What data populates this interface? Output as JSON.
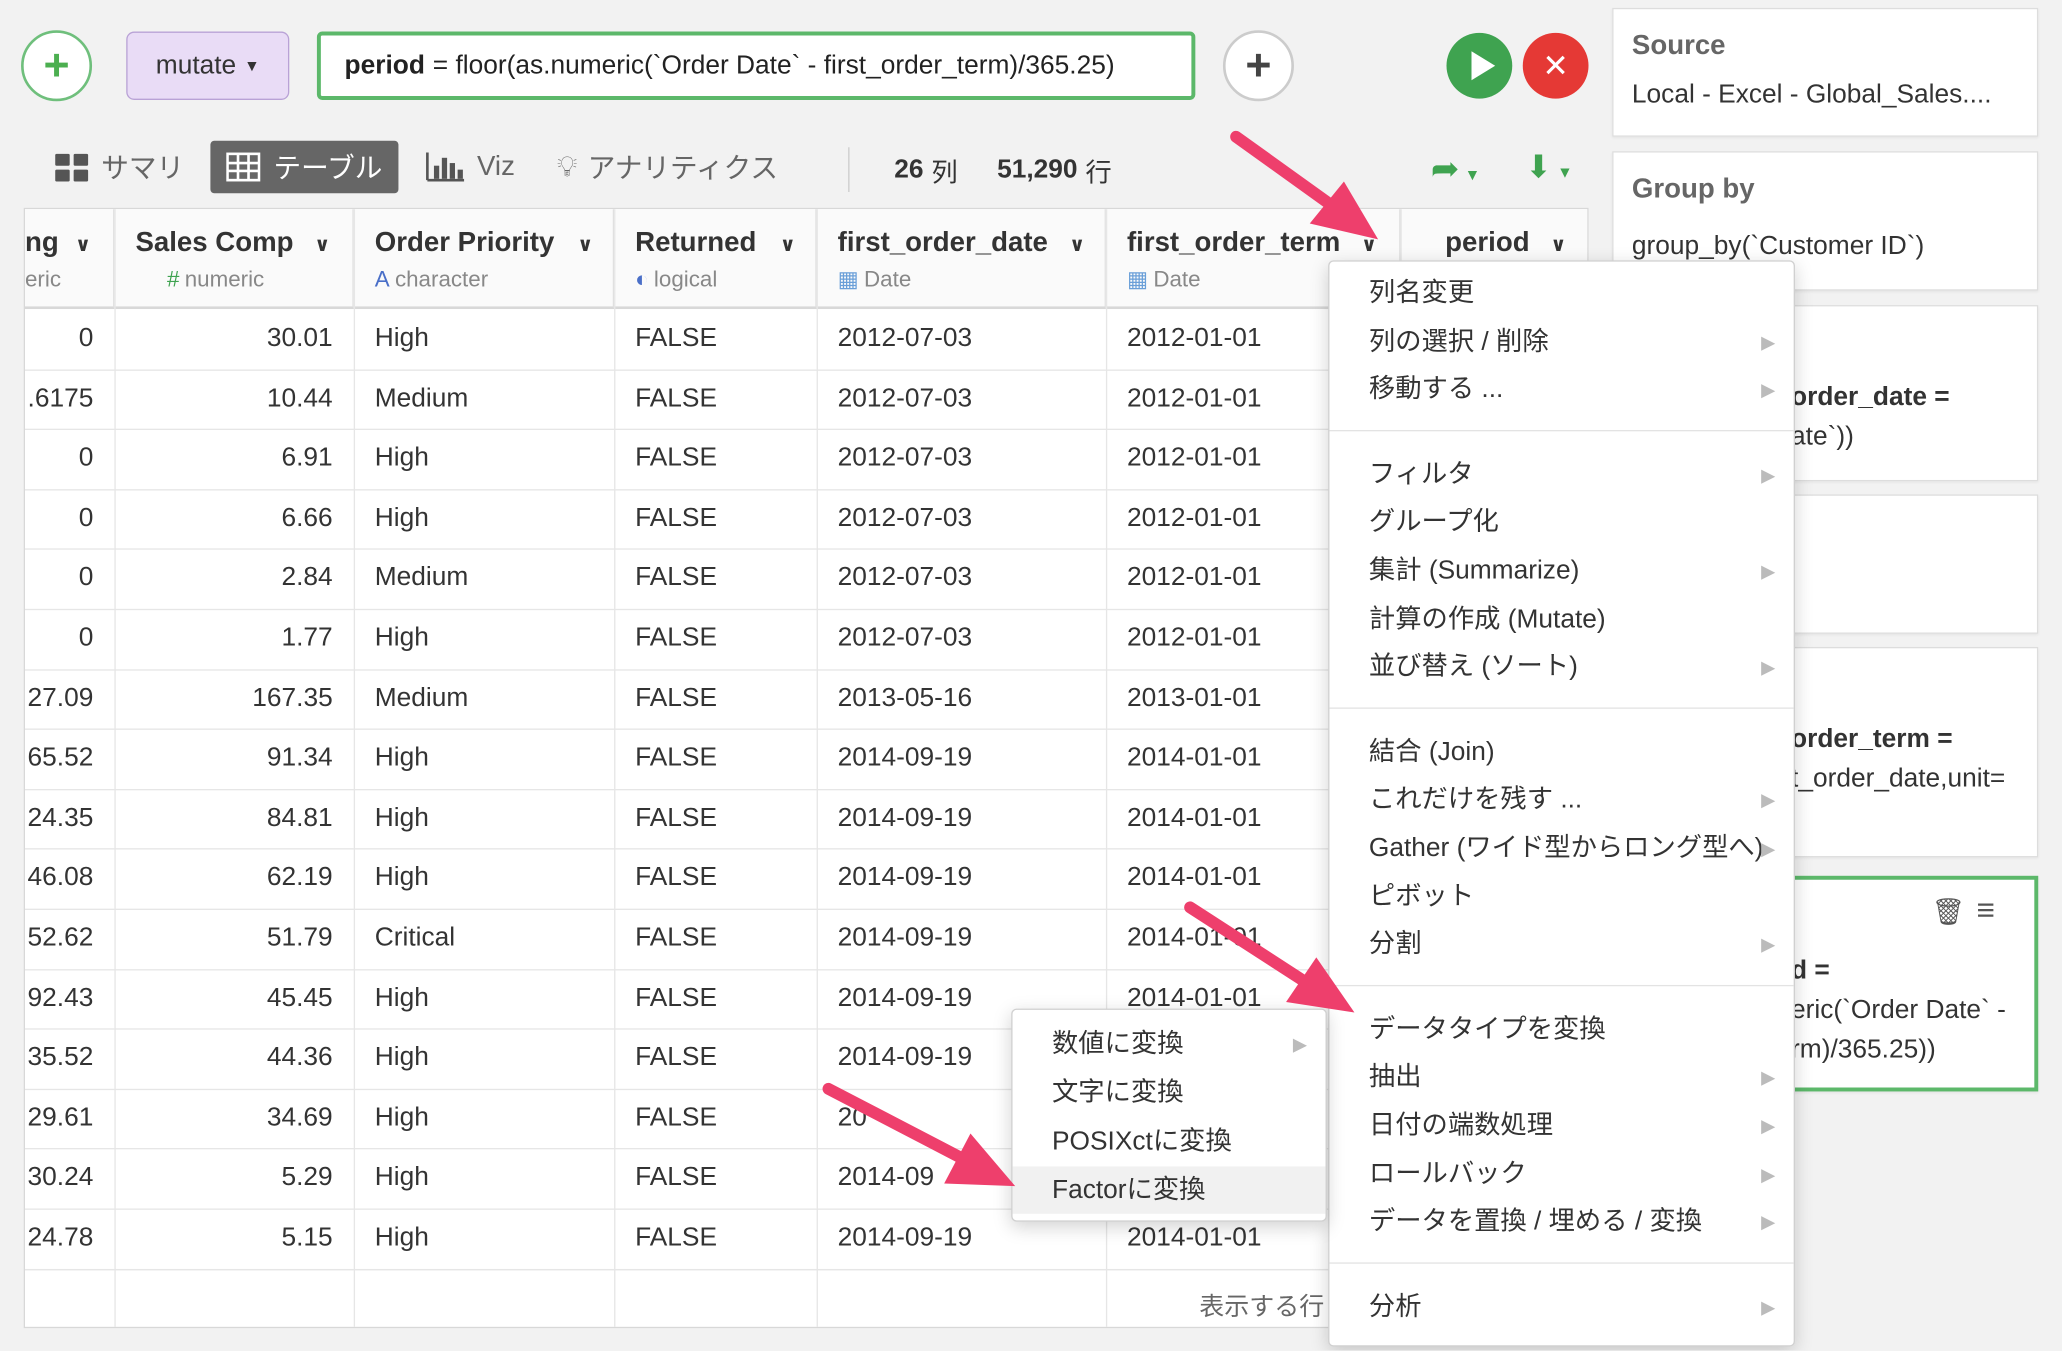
{
  "command": {
    "function_label": "mutate",
    "expression_var": "period",
    "expression_rest": "= floor(as.numeric(`Order Date` - first_order_term)/365.25)"
  },
  "view_tabs": [
    {
      "label": "サマリ",
      "icon": "summary-grid-icon"
    },
    {
      "label": "テーブル",
      "icon": "table-icon"
    },
    {
      "label": "Viz",
      "icon": "bar-chart-icon"
    },
    {
      "label": "アナリティクス",
      "icon": "lightbulb-icon"
    }
  ],
  "counts": {
    "cols": "26",
    "cols_unit": "列",
    "rows": "51,290",
    "rows_unit": "行"
  },
  "columns": [
    {
      "name": "ng",
      "type": "eric"
    },
    {
      "name": "Sales Comp",
      "type": "numeric",
      "type_icon": "#"
    },
    {
      "name": "Order Priority",
      "type": "character",
      "type_icon": "A"
    },
    {
      "name": "Returned",
      "type": "logical",
      "type_icon": "◐"
    },
    {
      "name": "first_order_date",
      "type": "Date",
      "type_icon": "▦"
    },
    {
      "name": "first_order_term",
      "type": "Date",
      "type_icon": "▦"
    },
    {
      "name": "period",
      "type": ""
    }
  ],
  "rows": [
    [
      "0",
      "30.01",
      "High",
      "FALSE",
      "2012-07-03",
      "2012-01-01"
    ],
    [
      ".6175",
      "10.44",
      "Medium",
      "FALSE",
      "2012-07-03",
      "2012-01-01"
    ],
    [
      "0",
      "6.91",
      "High",
      "FALSE",
      "2012-07-03",
      "2012-01-01"
    ],
    [
      "0",
      "6.66",
      "High",
      "FALSE",
      "2012-07-03",
      "2012-01-01"
    ],
    [
      "0",
      "2.84",
      "Medium",
      "FALSE",
      "2012-07-03",
      "2012-01-01"
    ],
    [
      "0",
      "1.77",
      "High",
      "FALSE",
      "2012-07-03",
      "2012-01-01"
    ],
    [
      "27.09",
      "167.35",
      "Medium",
      "FALSE",
      "2013-05-16",
      "2013-01-01"
    ],
    [
      "65.52",
      "91.34",
      "High",
      "FALSE",
      "2014-09-19",
      "2014-01-01"
    ],
    [
      "24.35",
      "84.81",
      "High",
      "FALSE",
      "2014-09-19",
      "2014-01-01"
    ],
    [
      "46.08",
      "62.19",
      "High",
      "FALSE",
      "2014-09-19",
      "2014-01-01"
    ],
    [
      "52.62",
      "51.79",
      "Critical",
      "FALSE",
      "2014-09-19",
      "2014-01-01"
    ],
    [
      "92.43",
      "45.45",
      "High",
      "FALSE",
      "2014-09-19",
      "2014-01-01"
    ],
    [
      "35.52",
      "44.36",
      "High",
      "FALSE",
      "2014-09-19",
      ""
    ],
    [
      "29.61",
      "34.69",
      "High",
      "FALSE",
      "20",
      ""
    ],
    [
      "30.24",
      "5.29",
      "High",
      "FALSE",
      "2014-09",
      ""
    ],
    [
      "24.78",
      "5.15",
      "High",
      "FALSE",
      "2014-09-19",
      "2014-01-01"
    ]
  ],
  "footer_text": "表示する行",
  "steps": [
    {
      "title": "Source",
      "text": "Local - Excel - Global_Sales...."
    },
    {
      "title": "Group by",
      "text": "group_by(`Customer ID`)"
    },
    {
      "line1": "order_date =",
      "line2": "ate`))"
    },
    {
      "line1": "",
      "line2": ""
    },
    {
      "line1": "order_term =",
      "line2": "t_order_date,unit="
    },
    {
      "line1": "d =",
      "line2": "eric(`Order Date` -",
      "line3": "rm)/365.25))"
    }
  ],
  "menu": {
    "groups": [
      [
        {
          "label": "列名変更",
          "sub": false
        },
        {
          "label": "列の選択 / 削除",
          "sub": true
        },
        {
          "label": "移動する ...",
          "sub": true
        }
      ],
      [
        {
          "label": "フィルタ",
          "sub": true
        },
        {
          "label": "グループ化",
          "sub": false
        },
        {
          "label": "集計 (Summarize)",
          "sub": true
        },
        {
          "label": "計算の作成 (Mutate)",
          "sub": false
        },
        {
          "label": "並び替え (ソート)",
          "sub": true
        }
      ],
      [
        {
          "label": "結合 (Join)",
          "sub": false
        },
        {
          "label": "これだけを残す ...",
          "sub": true
        },
        {
          "label": "Gather (ワイド型からロング型へ)",
          "sub": true
        },
        {
          "label": "ピボット",
          "sub": false
        },
        {
          "label": "分割",
          "sub": true
        }
      ],
      [
        {
          "label": "データタイプを変換",
          "sub": false
        },
        {
          "label": "抽出",
          "sub": true
        },
        {
          "label": "日付の端数処理",
          "sub": true
        },
        {
          "label": "ロールバック",
          "sub": true
        },
        {
          "label": "データを置換 / 埋める / 変換",
          "sub": true
        }
      ],
      [
        {
          "label": "分析",
          "sub": true
        }
      ]
    ]
  },
  "submenu": [
    {
      "label": "数値に変換",
      "sub": true
    },
    {
      "label": "文字に変換",
      "sub": false
    },
    {
      "label": "POSIXctに変換",
      "sub": false
    },
    {
      "label": "Factorに変換",
      "sub": false,
      "hover": true
    }
  ],
  "colors": {
    "accent_green": "#3fa350",
    "cancel_red": "#e53935",
    "arrow_pink": "#ee3f6c",
    "mutate_purple": "#e9dcf6"
  }
}
